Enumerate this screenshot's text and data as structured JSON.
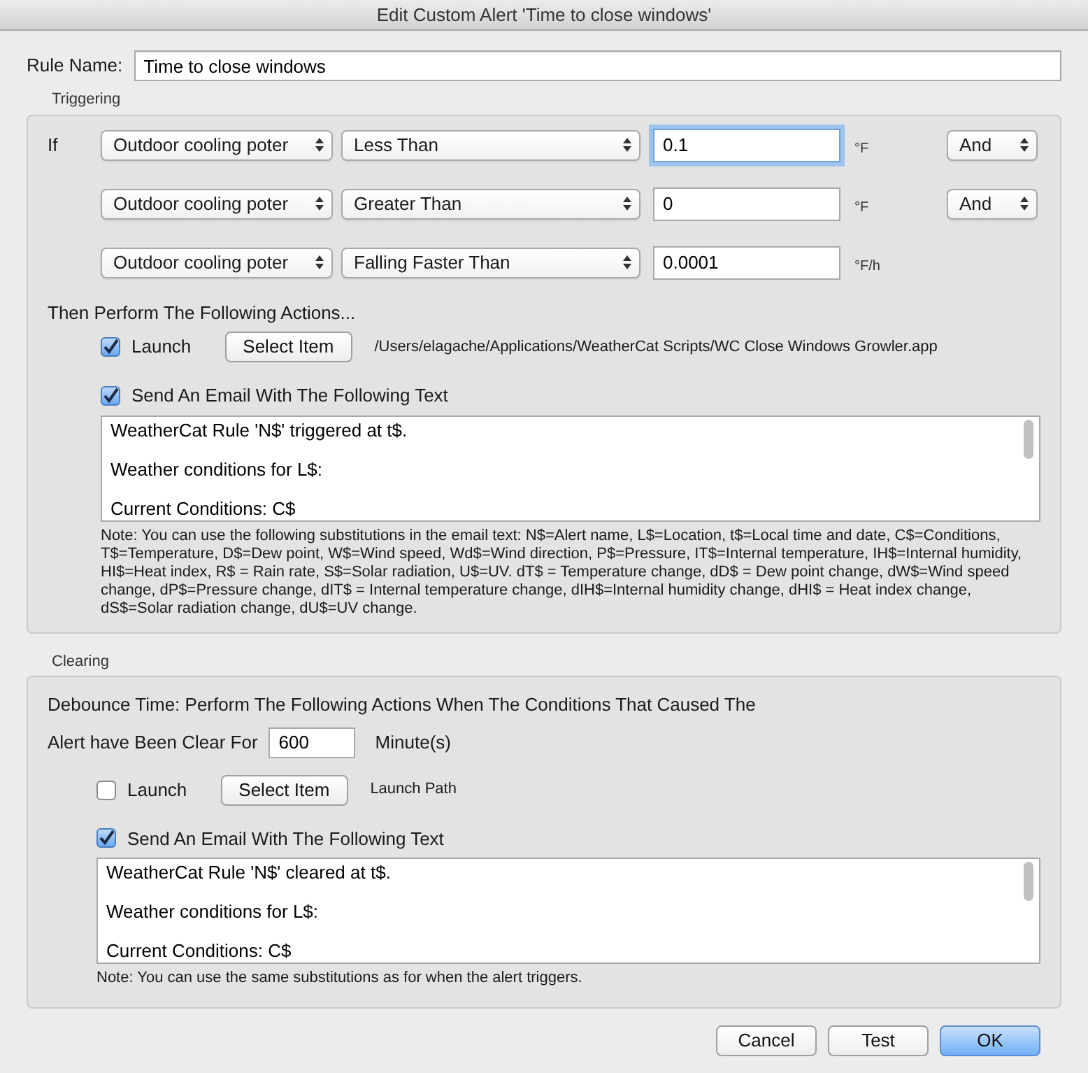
{
  "window": {
    "title": "Edit Custom Alert 'Time to close windows'"
  },
  "rule_name": {
    "label": "Rule Name:",
    "value": "Time to close windows"
  },
  "triggering": {
    "heading": "Triggering",
    "if_label": "If",
    "conditions": [
      {
        "field": "Outdoor cooling poter",
        "operator": "Less Than",
        "value": "0.1",
        "focused": true,
        "unit": "°F",
        "conjunction": "And"
      },
      {
        "field": "Outdoor cooling poter",
        "operator": "Greater Than",
        "value": "0",
        "focused": false,
        "unit": "°F",
        "conjunction": "And"
      },
      {
        "field": "Outdoor cooling poter",
        "operator": "Falling Faster Than",
        "value": "0.0001",
        "focused": false,
        "unit": "°F/h"
      }
    ],
    "actions_heading": "Then Perform The Following Actions...",
    "launch": {
      "label": "Launch",
      "checked": true,
      "button": "Select Item",
      "path": "/Users/elagache/Applications/WeatherCat Scripts/WC Close Windows Growler.app"
    },
    "email": {
      "label": "Send An Email With The Following Text",
      "checked": true,
      "text": "WeatherCat Rule 'N$' triggered at t$.\n\nWeather conditions for L$:\n\nCurrent Conditions: C$",
      "note": "Note: You can use the following substitutions in the email text: N$=Alert name, L$=Location, t$=Local time and date, C$=Conditions, T$=Temperature, D$=Dew point, W$=Wind speed, Wd$=Wind direction, P$=Pressure,  IT$=Internal temperature, IH$=Internal humidity, HI$=Heat index, R$ = Rain rate, S$=Solar radiation, U$=UV. dT$ = Temperature change, dD$ = Dew point change, dW$=Wind speed change, dP$=Pressure change, dIT$ = Internal temperature change, dIH$=Internal humidity change, dHI$ = Heat index change, dS$=Solar radiation change, dU$=UV change."
    }
  },
  "clearing": {
    "heading": "Clearing",
    "debounce_text": "Debounce Time: Perform The Following Actions When The Conditions That Caused The",
    "clear_label": "Alert have Been Clear For",
    "clear_value": "600",
    "clear_unit": "Minute(s)",
    "launch": {
      "label": "Launch",
      "checked": false,
      "button": "Select Item",
      "path": "Launch Path"
    },
    "email": {
      "label": "Send An Email With The Following Text",
      "checked": true,
      "text": "WeatherCat Rule 'N$' cleared at t$.\n\nWeather conditions for L$:\n\nCurrent Conditions: C$",
      "note": "Note: You can use the same substitutions as for when the alert triggers."
    }
  },
  "buttons": [
    {
      "label": "Cancel",
      "default": false
    },
    {
      "label": "Test",
      "default": false
    },
    {
      "label": "OK",
      "default": true
    }
  ]
}
